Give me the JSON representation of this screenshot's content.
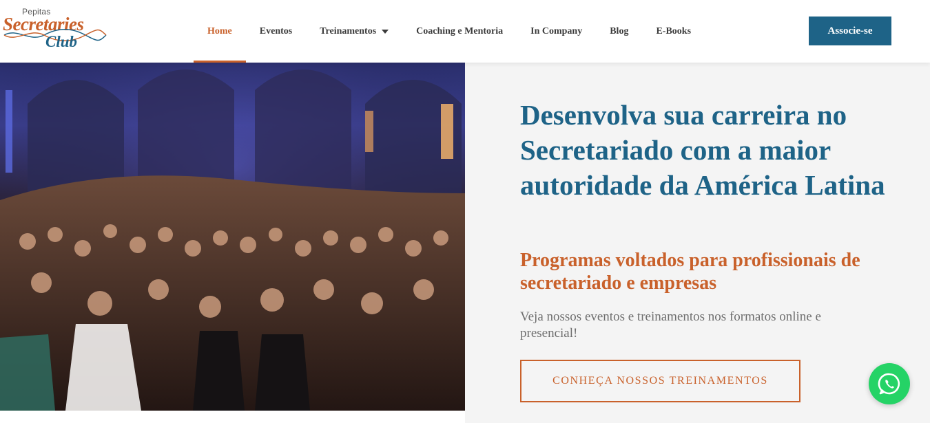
{
  "logo": {
    "small_text": "Pepitas",
    "main_text": "Secretaries",
    "club_text": "Club"
  },
  "nav": {
    "items": [
      {
        "label": "Home",
        "active": true
      },
      {
        "label": "Eventos",
        "active": false
      },
      {
        "label": "Treinamentos",
        "active": false,
        "dropdown": true
      },
      {
        "label": "Coaching e Mentoria",
        "active": false
      },
      {
        "label": "In Company",
        "active": false
      },
      {
        "label": "Blog",
        "active": false
      },
      {
        "label": "E-Books",
        "active": false
      }
    ],
    "cta_label": "Associe-se"
  },
  "hero": {
    "title": "Desenvolva sua carreira no Secretariado com a maior autoridade da América Latina",
    "subtitle": "Programas voltados para profissionais de secretariado e empresas",
    "text": "Veja nossos eventos e treinamentos nos formatos online e presencial!",
    "cta_label": "CONHEÇA NOSSOS TREINAMENTOS"
  },
  "icons": {
    "whatsapp": "whatsapp-icon",
    "dropdown": "chevron-down-icon"
  },
  "colors": {
    "brand_blue": "#1e6387",
    "brand_orange": "#c9612b",
    "whatsapp_green": "#25d366",
    "hero_bg": "#f4f4f4"
  }
}
